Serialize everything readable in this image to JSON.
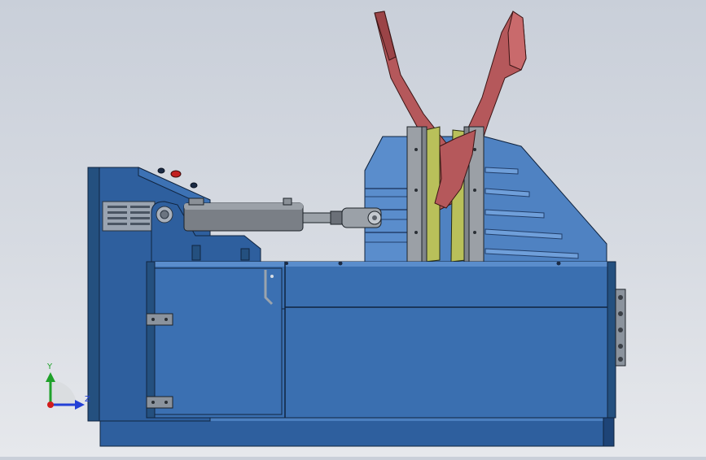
{
  "viewport": {
    "background": "#cfd4dc",
    "triad": {
      "y_label": "Y",
      "z_label": "Z",
      "y_color": "#1fa12a",
      "z_color": "#2340d6",
      "origin_color": "#d11c1c"
    }
  },
  "model": {
    "frame_color": "#2e5f9e",
    "frame_dark": "#1e4477",
    "panel_color": "#3a6fb0",
    "cylinder_color": "#7a7f86",
    "liner_color": "#b9c05a",
    "part_color": "#b5585b",
    "handle_color": "#9aa3ad"
  }
}
